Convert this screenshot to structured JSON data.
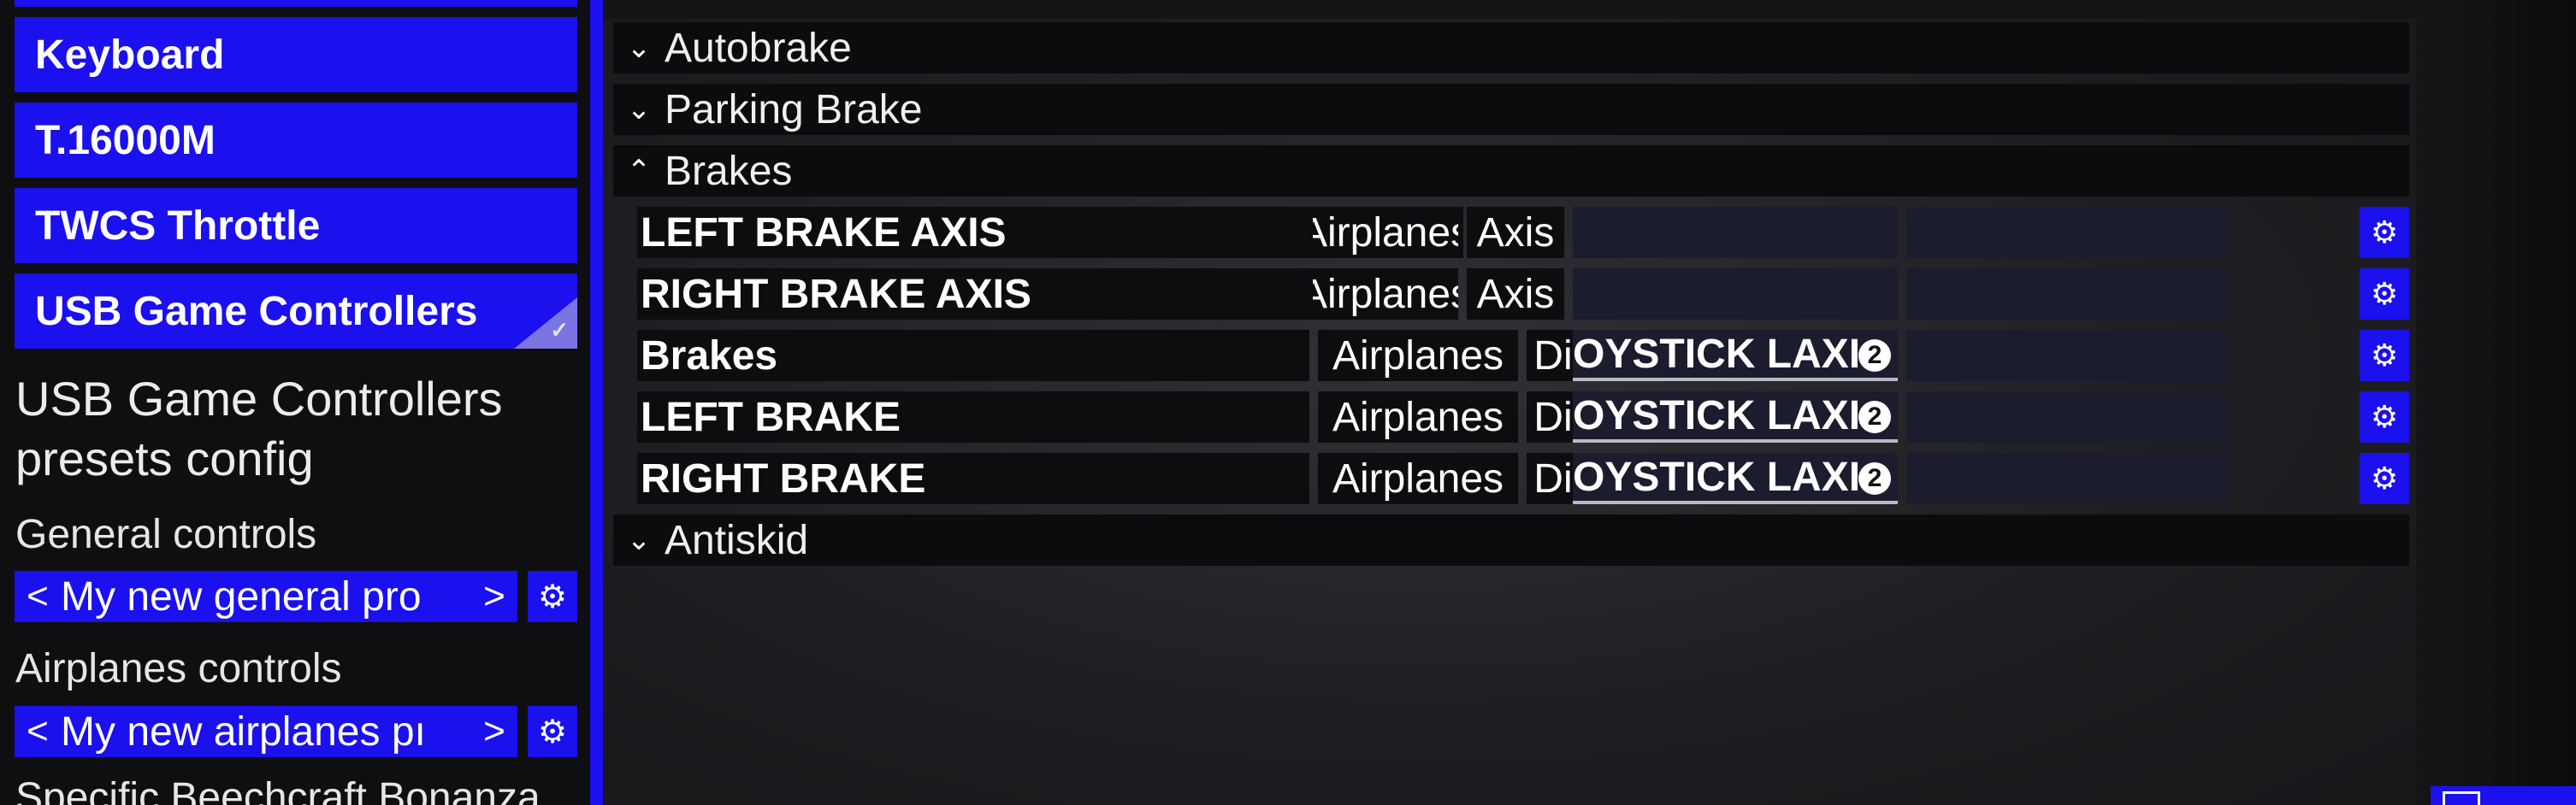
{
  "devices": [
    {
      "label": "Keyboard"
    },
    {
      "label": "T.16000M"
    },
    {
      "label": "TWCS Throttle"
    },
    {
      "label": "USB Game Controllers",
      "selected": true
    }
  ],
  "panel": {
    "title": "USB Game Controllers presets config",
    "general_label": "General controls",
    "general_preset": "My new general pro",
    "airplanes_label": "Airplanes controls",
    "airplanes_preset": "My new airplanes pı",
    "specific_label": "Specific Beechcraft Bonanza",
    "prev_arrow": "<",
    "next_arrow": ">"
  },
  "categories": {
    "autobrake": "Autobrake",
    "parking_brake": "Parking Brake",
    "brakes": "Brakes",
    "antiskid": "Antiskid"
  },
  "bindings": [
    {
      "action": "LEFT BRAKE AXIS",
      "context": "Airplanes",
      "type": "Axis",
      "slot1": "",
      "badge": ""
    },
    {
      "action": "RIGHT BRAKE AXIS",
      "context": "Airplanes",
      "type": "Axis",
      "slot1": "",
      "badge": ""
    },
    {
      "action": "Brakes",
      "context": "Airplanes",
      "type": "Digital",
      "slot1": "OYSTICK LAXI",
      "badge": "2"
    },
    {
      "action": "LEFT BRAKE",
      "context": "Airplanes",
      "type": "Digital",
      "slot1": "OYSTICK LAXI",
      "badge": "2"
    },
    {
      "action": "RIGHT BRAKE",
      "context": "Airplanes",
      "type": "Digital",
      "slot1": "OYSTICK LAXI",
      "badge": "2"
    }
  ],
  "icons": {
    "chevron_collapsed": "chevron-down-icon",
    "chevron_expanded": "chevron-up-icon",
    "settings": "gear-icon"
  },
  "colors": {
    "accent": "#1b10ee",
    "row_bg": "#0d0d10",
    "slot_bg": "#1b1d2e"
  }
}
